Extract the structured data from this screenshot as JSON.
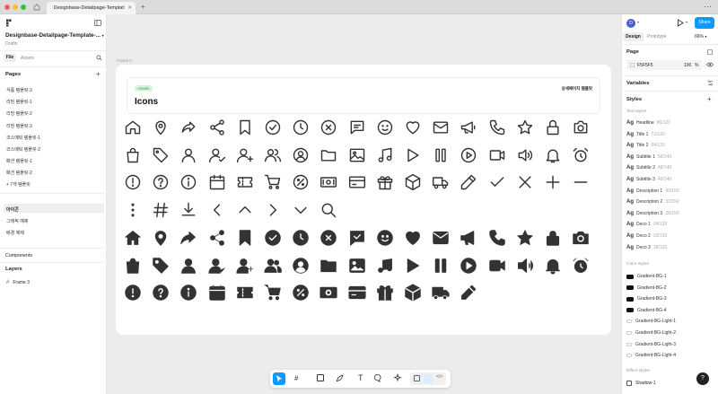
{
  "titlebar": {
    "tab_title": "Designbase-Detailpage-Templat:",
    "menu": "⋯",
    "plus": "+"
  },
  "left": {
    "file_name": "Designbase-Detailpage-Template-...",
    "file_caret": "▾",
    "drafts": "Drafts",
    "tab_file": "File",
    "tab_assets": "Assets",
    "pages_title": "Pages",
    "pages_add": "+",
    "pages": [
      "식품 템플릿-3",
      "리빙 템플릿-1",
      "리빙 템플릿-2",
      "리빙 템플릿-3",
      "코스메틱 템플릿-1",
      "코스메틱 템플릿-2",
      "패션 템플릿-1",
      "패션 템플릿-2",
      "+ 7개 템플릿"
    ],
    "pages2": [
      "아이콘",
      "그래픽 예제",
      "배경 예제"
    ],
    "components": "Components",
    "layers": "Layers",
    "layer_frame": "Frame 3"
  },
  "canvas": {
    "frame_label": "Frame 3",
    "badge": "Assets",
    "title": "Icons",
    "top_right": "상세페이지 템플릿"
  },
  "right": {
    "avatar": "D",
    "share": "Share",
    "tab_design": "Design",
    "tab_prototype": "Prototype",
    "zoom": "66%",
    "page_title": "Page",
    "page_color": "F5F5F5",
    "page_opacity": "100",
    "page_pct": "%",
    "variables": "Variables",
    "styles": "Styles",
    "text_styles": "Text styles",
    "text_styles_list": [
      {
        "ag": "Ag",
        "name": "Headline",
        "meta": "80/120"
      },
      {
        "ag": "Ag",
        "name": "Title 1",
        "meta": "72/120"
      },
      {
        "ag": "Ag",
        "name": "Title 2",
        "meta": "64/120"
      },
      {
        "ag": "Ag",
        "name": "Subtitle 1",
        "meta": "56/140"
      },
      {
        "ag": "Ag",
        "name": "Subtitle 2",
        "meta": "48/140"
      },
      {
        "ag": "Ag",
        "name": "Subtitle 3",
        "meta": "40/140"
      },
      {
        "ag": "Ag",
        "name": "Description 1",
        "meta": "40/150"
      },
      {
        "ag": "Ag",
        "name": "Description 2",
        "meta": "32/150"
      },
      {
        "ag": "Ag",
        "name": "Description 3",
        "meta": "28/150"
      },
      {
        "ag": "Ag",
        "name": "Deco 1",
        "meta": "24/120"
      },
      {
        "ag": "Ag",
        "name": "Deco 2",
        "meta": "20/120"
      },
      {
        "ag": "Ag",
        "name": "Deco 3",
        "meta": "18/120"
      }
    ],
    "color_styles": "Color styles",
    "color_styles_list": [
      "Gradient-BG-1",
      "Gradient-BG-2",
      "Gradient-BG-3",
      "Gradient-BG-4",
      "Gradient-BG-Light-1",
      "Gradient-BG-Light-2",
      "Gradient-BG-Light-3",
      "Gradient-BG-Light-4"
    ],
    "effect_styles": "Effect styles",
    "effect_item": "Shadow-1",
    "help": "?"
  },
  "colors": {
    "share_blue": "#0d99ff",
    "tool_active": "#0d99ff",
    "badge_bg": "#d8f5e1",
    "badge_text": "#2a9d57",
    "traffic_red": "#ff5f57",
    "traffic_yellow": "#febc2e",
    "traffic_green": "#28c840"
  },
  "icons_outline": [
    "home",
    "pin",
    "share-arrow",
    "share-nodes",
    "bookmark",
    "check-circle",
    "clock",
    "x-circle",
    "message",
    "smile",
    "heart",
    "mail",
    "megaphone",
    "phone",
    "star",
    "lock",
    "camera",
    "bag",
    "tag",
    "user",
    "user-check",
    "user-plus",
    "users",
    "user-circle",
    "folder",
    "image",
    "music",
    "play",
    "pause",
    "play-circle",
    "video",
    "volume",
    "bell",
    "alarm",
    "alert-circle",
    "help-circle",
    "info-circle",
    "calendar",
    "ticket",
    "cart",
    "percent",
    "money",
    "card",
    "gift",
    "box",
    "truck",
    "pencil",
    "check",
    "close",
    "plus",
    "minus",
    "more-vertical",
    "hash",
    "download",
    "chevron-left",
    "chevron-up",
    "chevron-right",
    "chevron-down",
    "search"
  ],
  "icons_filled": [
    "home",
    "pin",
    "share-arrow",
    "share-nodes",
    "bookmark",
    "check-circle",
    "clock",
    "x-circle",
    "message-check",
    "smile",
    "heart",
    "mail",
    "megaphone",
    "phone",
    "star",
    "lock",
    "camera",
    "bag",
    "tag",
    "user",
    "user-check",
    "user-plus",
    "users",
    "user-circle",
    "folder",
    "image",
    "music",
    "play",
    "pause",
    "play-circle",
    "video",
    "volume",
    "bell",
    "alarm",
    "alert-circle",
    "help-circle",
    "info-circle",
    "calendar",
    "ticket",
    "cart",
    "percent",
    "money",
    "card",
    "gift",
    "box",
    "truck",
    "pencil"
  ]
}
